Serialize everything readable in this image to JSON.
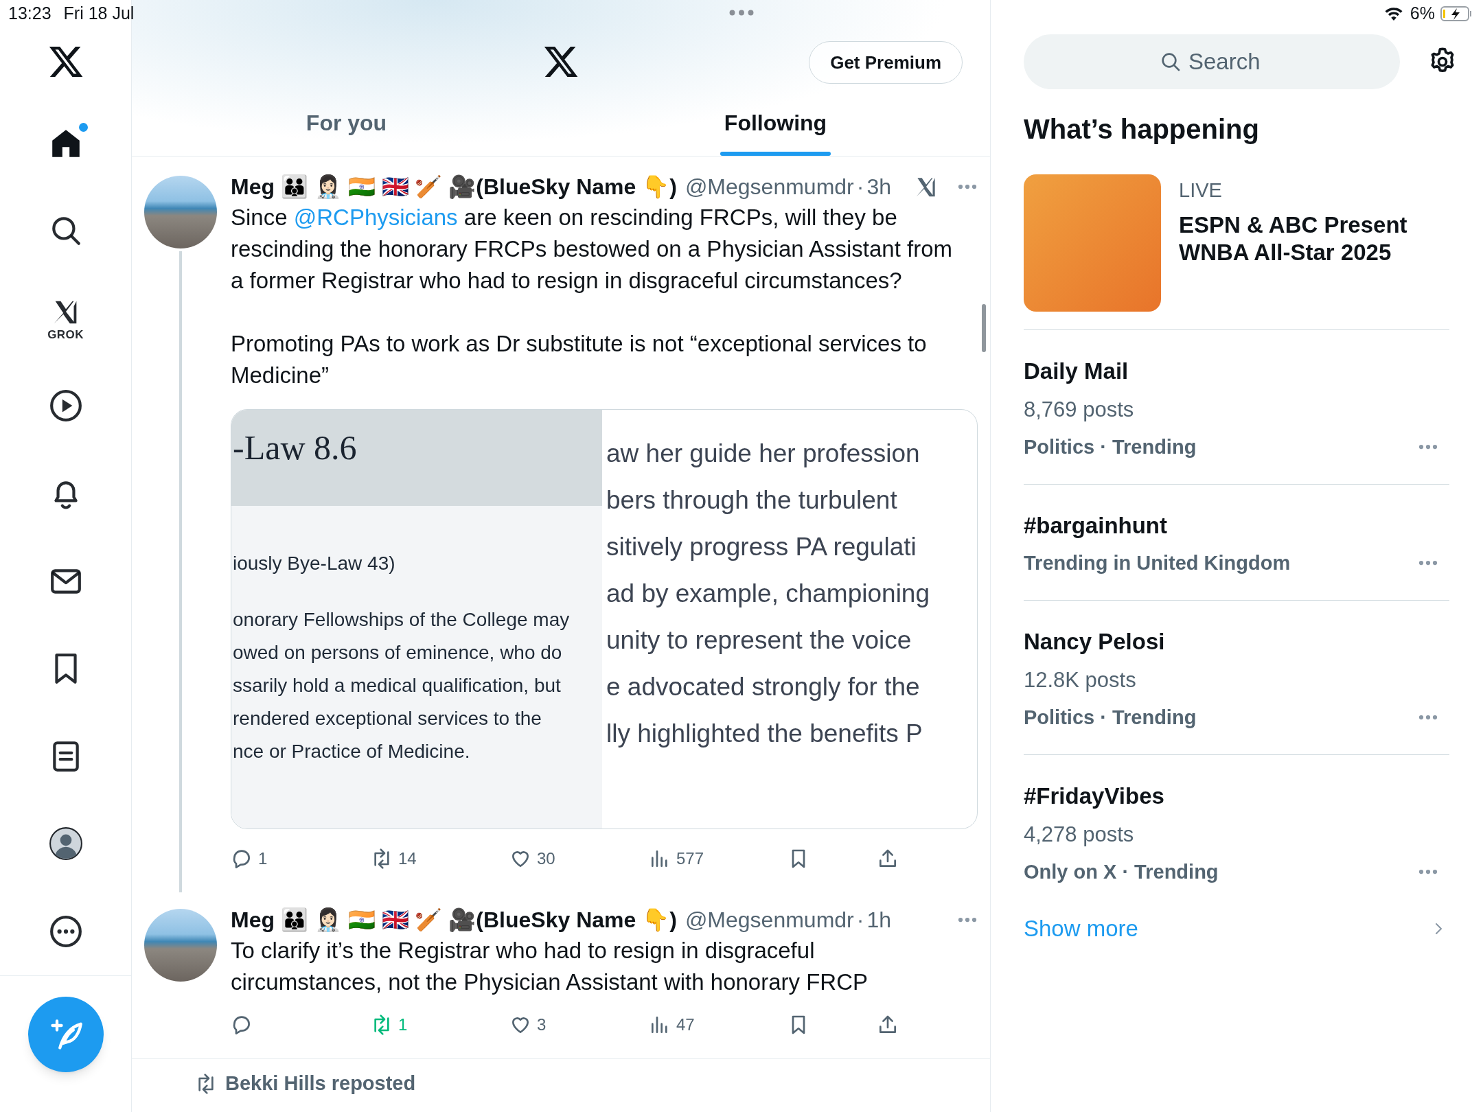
{
  "status_bar": {
    "time": "13:23",
    "date": "Fri 18 Jul",
    "battery": "6%"
  },
  "sidebar": {
    "items": [
      {
        "kind": "home",
        "selected": true,
        "badge": true
      },
      {
        "kind": "search",
        "selected": false,
        "badge": false
      },
      {
        "kind": "grok",
        "label": "GROK",
        "selected": false,
        "badge": false
      },
      {
        "kind": "video",
        "selected": false,
        "badge": false
      },
      {
        "kind": "notifications",
        "selected": false,
        "badge": false
      },
      {
        "kind": "messages",
        "selected": false,
        "badge": false
      },
      {
        "kind": "bookmarks",
        "selected": false,
        "badge": false
      },
      {
        "kind": "lists",
        "selected": false,
        "badge": false
      },
      {
        "kind": "profile",
        "selected": false,
        "badge": false
      },
      {
        "kind": "more",
        "selected": false,
        "badge": false
      }
    ]
  },
  "header": {
    "premium_button": "Get Premium"
  },
  "tabs": [
    {
      "label": "For you",
      "selected": false
    },
    {
      "label": "Following",
      "selected": true
    }
  ],
  "posts": [
    {
      "name": "Meg 👪 👩🏻‍⚕️ 🇮🇳 🇬🇧 🏏 🎥(BlueSky Name 👇)",
      "handle": "@Megsenmumdr",
      "separator": "·",
      "time": "3h",
      "grok": true,
      "thread_line": true,
      "paragraphs": [
        [
          {
            "kind": "text",
            "text": "Since "
          },
          {
            "kind": "mention",
            "text": "@RCPhysicians"
          },
          {
            "kind": "text",
            "text": " are keen on rescinding FRCPs, will they be rescinding the honorary FRCPs bestowed on a Physician Assistant from a former Registrar who had to resign in disgraceful circumstances?"
          }
        ],
        [
          {
            "kind": "text",
            "text": "Promoting PAs to work as Dr substitute is not “exceptional services to Medicine”"
          }
        ]
      ],
      "media": {
        "heading": "-Law 8.6",
        "left_lines": [
          "iously Bye-Law 43)",
          "onorary Fellowships of the College may",
          "owed on persons of eminence, who do",
          "ssarily hold a medical qualification, but",
          "rendered exceptional services to the",
          "nce or Practice of Medicine."
        ],
        "right_lines": [
          "aw her guide her profession",
          "bers through the turbulent",
          "sitively progress PA regulati",
          "ad by example, championing",
          "unity to represent the voice",
          "e advocated strongly for the",
          "lly highlighted the benefits P"
        ]
      },
      "actions": {
        "replies": "1",
        "reposts": "14",
        "likes": "30",
        "views": "577"
      },
      "reposted": false
    },
    {
      "name": "Meg 👪 👩🏻‍⚕️ 🇮🇳 🇬🇧 🏏 🎥(BlueSky Name 👇)",
      "handle": "@Megsenmumdr",
      "separator": "·",
      "time": "1h",
      "grok": false,
      "thread_line": false,
      "paragraphs": [
        [
          {
            "kind": "text",
            "text": "To clarify it’s the Registrar who had to resign in disgraceful circumstances, not the Physician Assistant with honorary FRCP"
          }
        ]
      ],
      "actions": {
        "reposts": "1",
        "likes": "3",
        "views": "47"
      },
      "reposted": true
    }
  ],
  "repost_notice": "Bekki Hills reposted",
  "search": {
    "placeholder": "Search"
  },
  "trends": {
    "title": "What’s happening",
    "items": [
      {
        "kind": "live",
        "label": "LIVE",
        "title": "ESPN & ABC Present WNBA All-Star 2025"
      },
      {
        "kind": "trend",
        "title": "Daily Mail",
        "posts": "8,769 posts",
        "meta": "Politics · Trending"
      },
      {
        "kind": "trend",
        "title": "#bargainhunt",
        "meta": "Trending in United Kingdom"
      },
      {
        "kind": "trend",
        "title": "Nancy Pelosi",
        "posts": "12.8K posts",
        "meta": "Politics · Trending"
      },
      {
        "kind": "trend",
        "title": "#FridayVibes",
        "posts": "4,278 posts",
        "meta": "Only on X · Trending"
      }
    ],
    "show_more": "Show more"
  }
}
